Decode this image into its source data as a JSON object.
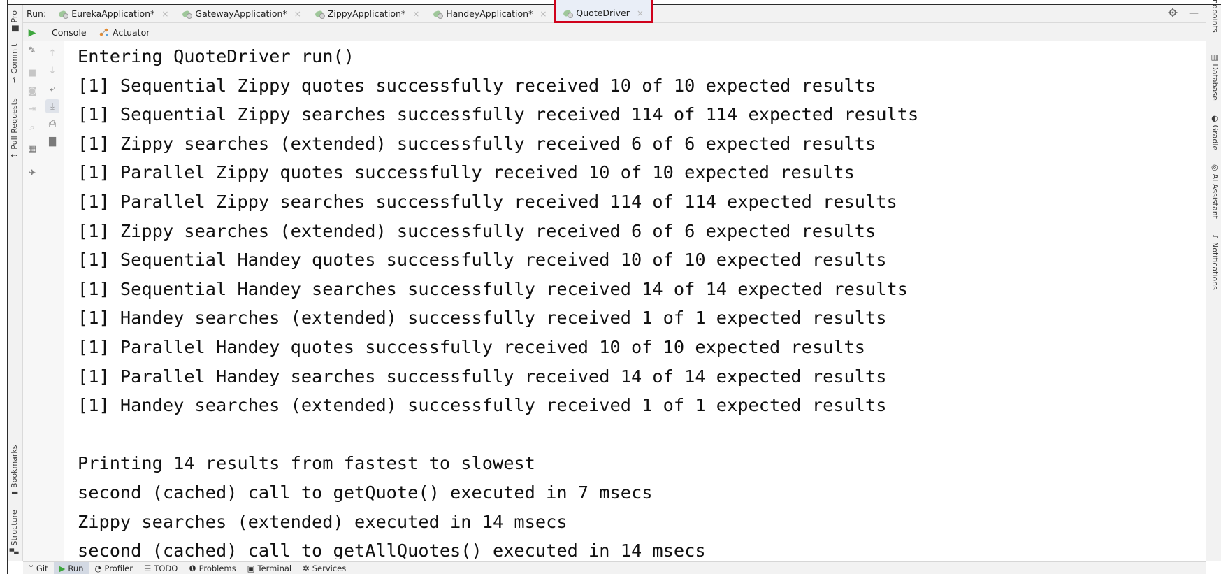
{
  "run_tool_window": {
    "run_label": "Run:",
    "tabs": [
      {
        "label": "EurekaApplication*",
        "icon": "spring-boot-icon",
        "closable": true
      },
      {
        "label": "GatewayApplication*",
        "icon": "spring-boot-icon",
        "closable": true
      },
      {
        "label": "ZippyApplication*",
        "icon": "spring-boot-icon",
        "closable": true
      },
      {
        "label": "HandeyApplication*",
        "icon": "spring-boot-icon",
        "closable": true
      },
      {
        "label": "QuoteDriver",
        "icon": "spring-boot-icon",
        "closable": true,
        "active": true,
        "highlighted": true
      }
    ],
    "subtabs": [
      {
        "label": "Console",
        "active": true
      },
      {
        "label": "Actuator",
        "icon": "actuator-icon"
      }
    ],
    "close_glyph": "×",
    "settings_icon": "gear-icon",
    "hide_icon": "minimize-icon",
    "highlight_color": "#d0021b"
  },
  "left_sidebar": {
    "top": [
      {
        "label": "Project",
        "visible_text": "Pro",
        "icon": "folder-icon"
      },
      {
        "label": "Commit",
        "icon": "commit-icon"
      },
      {
        "label": "Pull Requests",
        "icon": "pull-request-icon"
      }
    ],
    "bottom": [
      {
        "label": "Bookmarks",
        "icon": "bookmark-icon"
      },
      {
        "label": "Structure",
        "icon": "structure-icon"
      }
    ]
  },
  "right_sidebar": [
    {
      "label": "Endpoints",
      "visible_text": "ndpoints"
    },
    {
      "label": "Database",
      "icon": "database-icon"
    },
    {
      "label": "Gradle",
      "icon": "gradle-icon"
    },
    {
      "label": "AI Assistant",
      "icon": "ai-assistant-icon"
    },
    {
      "label": "Notifications",
      "icon": "bell-icon"
    }
  ],
  "console_lines": [
    "Entering QuoteDriver run()",
    "[1] Sequential Zippy quotes successfully received 10 of 10 expected results",
    "[1] Sequential Zippy searches successfully received 114 of 114 expected results",
    "[1] Zippy searches (extended) successfully received 6 of 6 expected results",
    "[1] Parallel Zippy quotes successfully received 10 of 10 expected results",
    "[1] Parallel Zippy searches successfully received 114 of 114 expected results",
    "[1] Zippy searches (extended) successfully received 6 of 6 expected results",
    "[1] Sequential Handey quotes successfully received 10 of 10 expected results",
    "[1] Sequential Handey searches successfully received 14 of 14 expected results",
    "[1] Handey searches (extended) successfully received 1 of 1 expected results",
    "[1] Parallel Handey quotes successfully received 10 of 10 expected results",
    "[1] Parallel Handey searches successfully received 14 of 14 expected results",
    "[1] Handey searches (extended) successfully received 1 of 1 expected results",
    "",
    "Printing 14 results from fastest to slowest",
    "second (cached) call to getQuote() executed in 7 msecs",
    "Zippy searches (extended) executed in 14 msecs",
    "second (cached) call to getAllQuotes() executed in 14 msecs"
  ],
  "bottom_bar": [
    {
      "label": "Git",
      "icon": "git-branch-icon"
    },
    {
      "label": "Run",
      "icon": "run-icon",
      "active": true
    },
    {
      "label": "Profiler",
      "icon": "profiler-icon"
    },
    {
      "label": "TODO",
      "icon": "list-icon"
    },
    {
      "label": "Problems",
      "icon": "problems-icon"
    },
    {
      "label": "Terminal",
      "icon": "terminal-icon"
    },
    {
      "label": "Services",
      "icon": "services-icon"
    }
  ]
}
